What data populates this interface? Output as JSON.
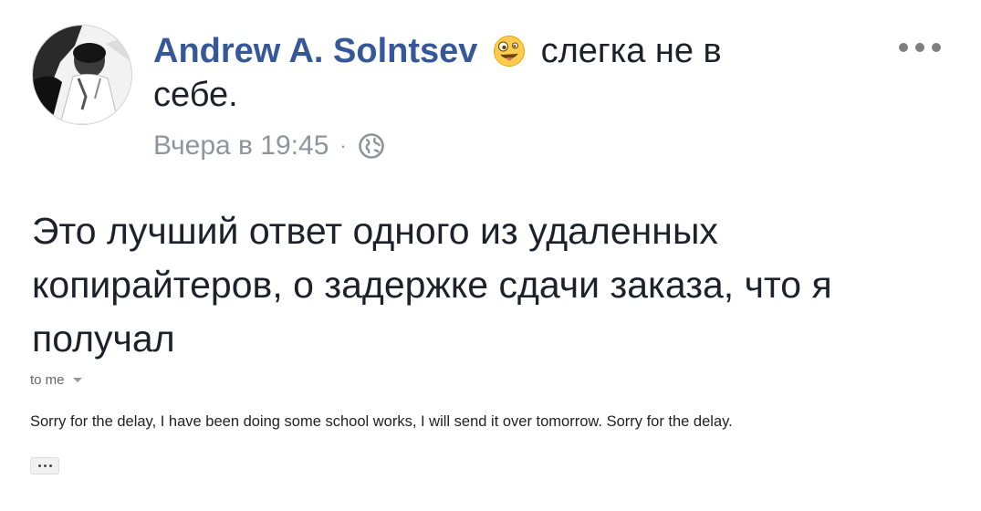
{
  "post": {
    "author_name": "Andrew A. Solntsev",
    "feeling_icon": "zany-face-emoji",
    "feeling_text": "слегка не в себе.",
    "timestamp": "Вчера в 19:45",
    "separator": "·",
    "privacy_icon": "globe-icon",
    "options_icon": "ellipsis-icon",
    "body_text": "Это лучший ответ одного из удаленных копирайтеров, о задержке сдачи заказа, что я получал"
  },
  "email": {
    "recipient_label": "to me",
    "body": "Sorry for the delay, I have been doing some school works, I will send it over tomorrow. Sorry for the delay.",
    "expand_icon": "show-trimmed-content-icon"
  },
  "colors": {
    "author_link": "#365899",
    "meta_text": "#90949c",
    "body_text": "#1d2129"
  }
}
